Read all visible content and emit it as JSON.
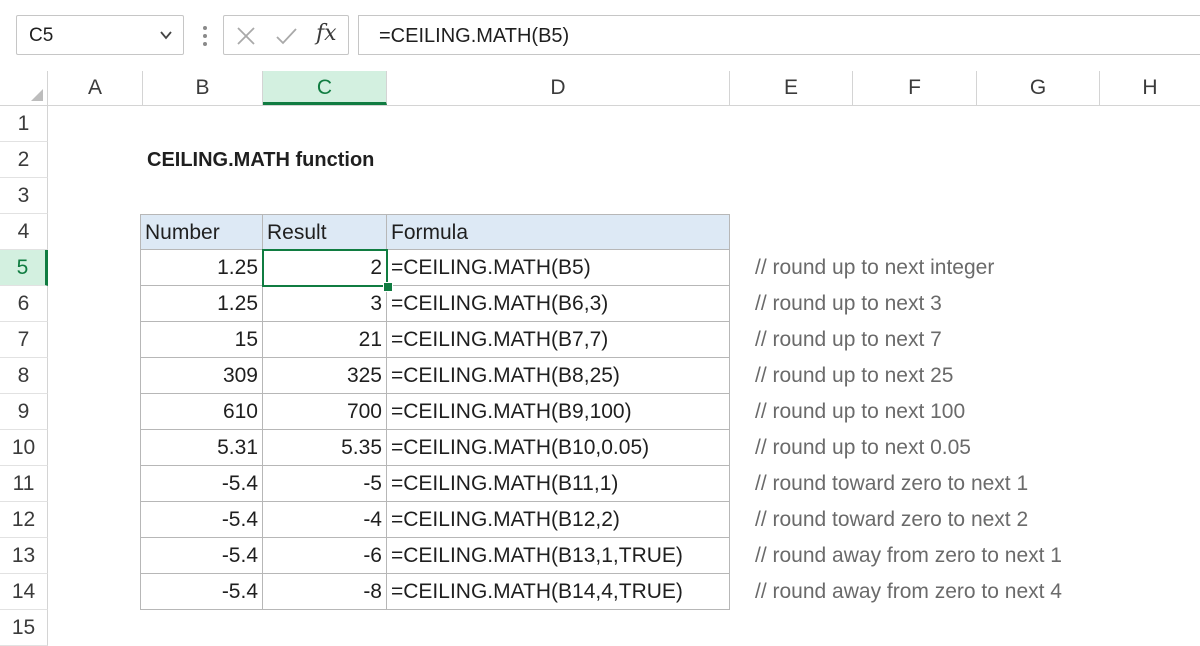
{
  "formula_bar": {
    "name_box": "C5",
    "fx_label": "fx",
    "formula": "=CEILING.MATH(B5)"
  },
  "columns": [
    "A",
    "B",
    "C",
    "D",
    "E",
    "F",
    "G",
    "H"
  ],
  "rows": [
    "1",
    "2",
    "3",
    "4",
    "5",
    "6",
    "7",
    "8",
    "9",
    "10",
    "11",
    "12",
    "13",
    "14",
    "15"
  ],
  "title": "CEILING.MATH function",
  "table": {
    "headers": [
      "Number",
      "Result",
      "Formula"
    ],
    "rows": [
      {
        "number": "1.25",
        "result": "2",
        "formula": "=CEILING.MATH(B5)",
        "comment": "// round up to next integer"
      },
      {
        "number": "1.25",
        "result": "3",
        "formula": "=CEILING.MATH(B6,3)",
        "comment": "// round up to next 3"
      },
      {
        "number": "15",
        "result": "21",
        "formula": "=CEILING.MATH(B7,7)",
        "comment": "// round up to next 7"
      },
      {
        "number": "309",
        "result": "325",
        "formula": "=CEILING.MATH(B8,25)",
        "comment": "// round up to next 25"
      },
      {
        "number": "610",
        "result": "700",
        "formula": "=CEILING.MATH(B9,100)",
        "comment": "// round up to next 100"
      },
      {
        "number": "5.31",
        "result": "5.35",
        "formula": "=CEILING.MATH(B10,0.05)",
        "comment": "// round up to next 0.05"
      },
      {
        "number": "-5.4",
        "result": "-5",
        "formula": "=CEILING.MATH(B11,1)",
        "comment": "// round toward zero to next 1"
      },
      {
        "number": "-5.4",
        "result": "-4",
        "formula": "=CEILING.MATH(B12,2)",
        "comment": "// round toward zero to next 2"
      },
      {
        "number": "-5.4",
        "result": "-6",
        "formula": "=CEILING.MATH(B13,1,TRUE)",
        "comment": "// round away from zero to next 1"
      },
      {
        "number": "-5.4",
        "result": "-8",
        "formula": "=CEILING.MATH(B14,4,TRUE)",
        "comment": "// round away from zero to next 4"
      }
    ]
  },
  "selection": {
    "column": "C",
    "row": "5"
  },
  "colors": {
    "accent": "#107c41",
    "header_fill": "#dde9f5"
  }
}
